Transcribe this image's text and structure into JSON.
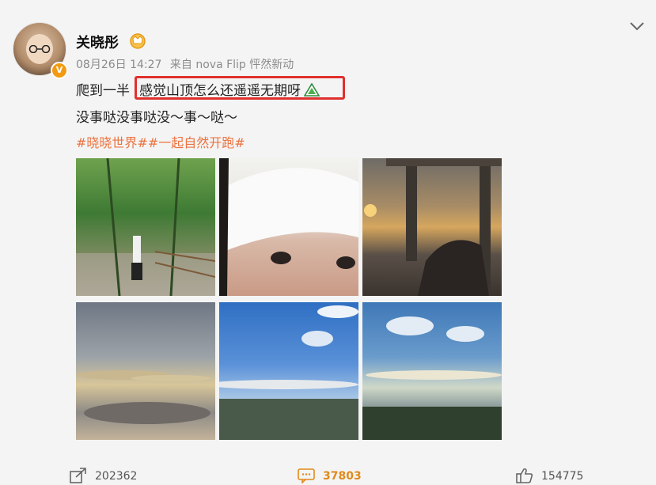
{
  "header": {
    "username": "关晓彤",
    "timestamp": "08月26日 14:27",
    "source": "来自 nova Flip 怦然新动",
    "verified_badge": "V"
  },
  "post": {
    "line1_prefix": "爬到一半",
    "line1_highlight": "感觉山顶怎么还遥遥无期呀",
    "line2": "没事哒没事哒没～事～哒～",
    "tags": "#晓晓世界##一起自然开跑#"
  },
  "photos": [
    {
      "icon": "mountain-stairs-photo"
    },
    {
      "icon": "selfie-photo"
    },
    {
      "icon": "sunset-pavilion-photo"
    },
    {
      "icon": "cloudy-sunset-photo"
    },
    {
      "icon": "blue-sky-photo"
    },
    {
      "icon": "sky-landscape-photo"
    }
  ],
  "footer": {
    "share_count": "202362",
    "comment_count": "37803",
    "like_count": "154775"
  },
  "colors": {
    "highlight_border": "#e0302e",
    "tag": "#eb7340",
    "comment_accent": "#e08a1b",
    "badge": "#f39a12"
  }
}
